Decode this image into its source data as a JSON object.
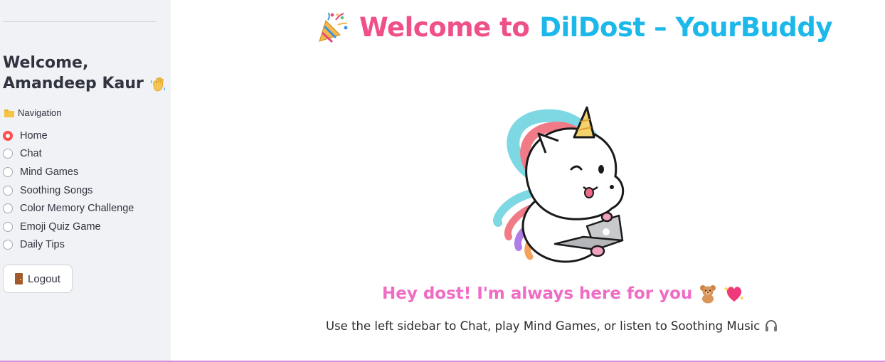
{
  "sidebar": {
    "welcome_line1": "Welcome,",
    "welcome_line2": "Amandeep Kaur",
    "welcome_emoji": "waving-hand-icon",
    "nav_label": "Navigation",
    "nav_icon": "folder-icon",
    "nav_items": [
      {
        "label": "Home",
        "selected": true
      },
      {
        "label": "Chat",
        "selected": false
      },
      {
        "label": "Mind Games",
        "selected": false
      },
      {
        "label": "Soothing Songs",
        "selected": false
      },
      {
        "label": "Color Memory Challenge",
        "selected": false
      },
      {
        "label": "Emoji Quiz Game",
        "selected": false
      },
      {
        "label": "Daily Tips",
        "selected": false
      }
    ],
    "logout_label": "Logout",
    "logout_icon": "door-icon"
  },
  "main": {
    "title_part1": "Welcome to",
    "title_part2": "DilDost – YourBuddy",
    "title_icon": "party-popper-icon",
    "hero_image": "unicorn-with-laptop-illustration",
    "tagline": "Hey dost! I'm always here for you",
    "tagline_icons": [
      "teddy-bear-icon",
      "sparkling-heart-icon"
    ],
    "subtext": "Use the left sidebar to Chat, play Mind Games, or listen to Soothing Music",
    "subtext_icon": "headphones-icon"
  },
  "colors": {
    "sidebar_bg": "#f0f2f6",
    "accent_radio": "#ff4b4b",
    "title_pink": "#f0508a",
    "title_blue": "#1cb8ea",
    "tagline_pink": "#f06bc4"
  }
}
